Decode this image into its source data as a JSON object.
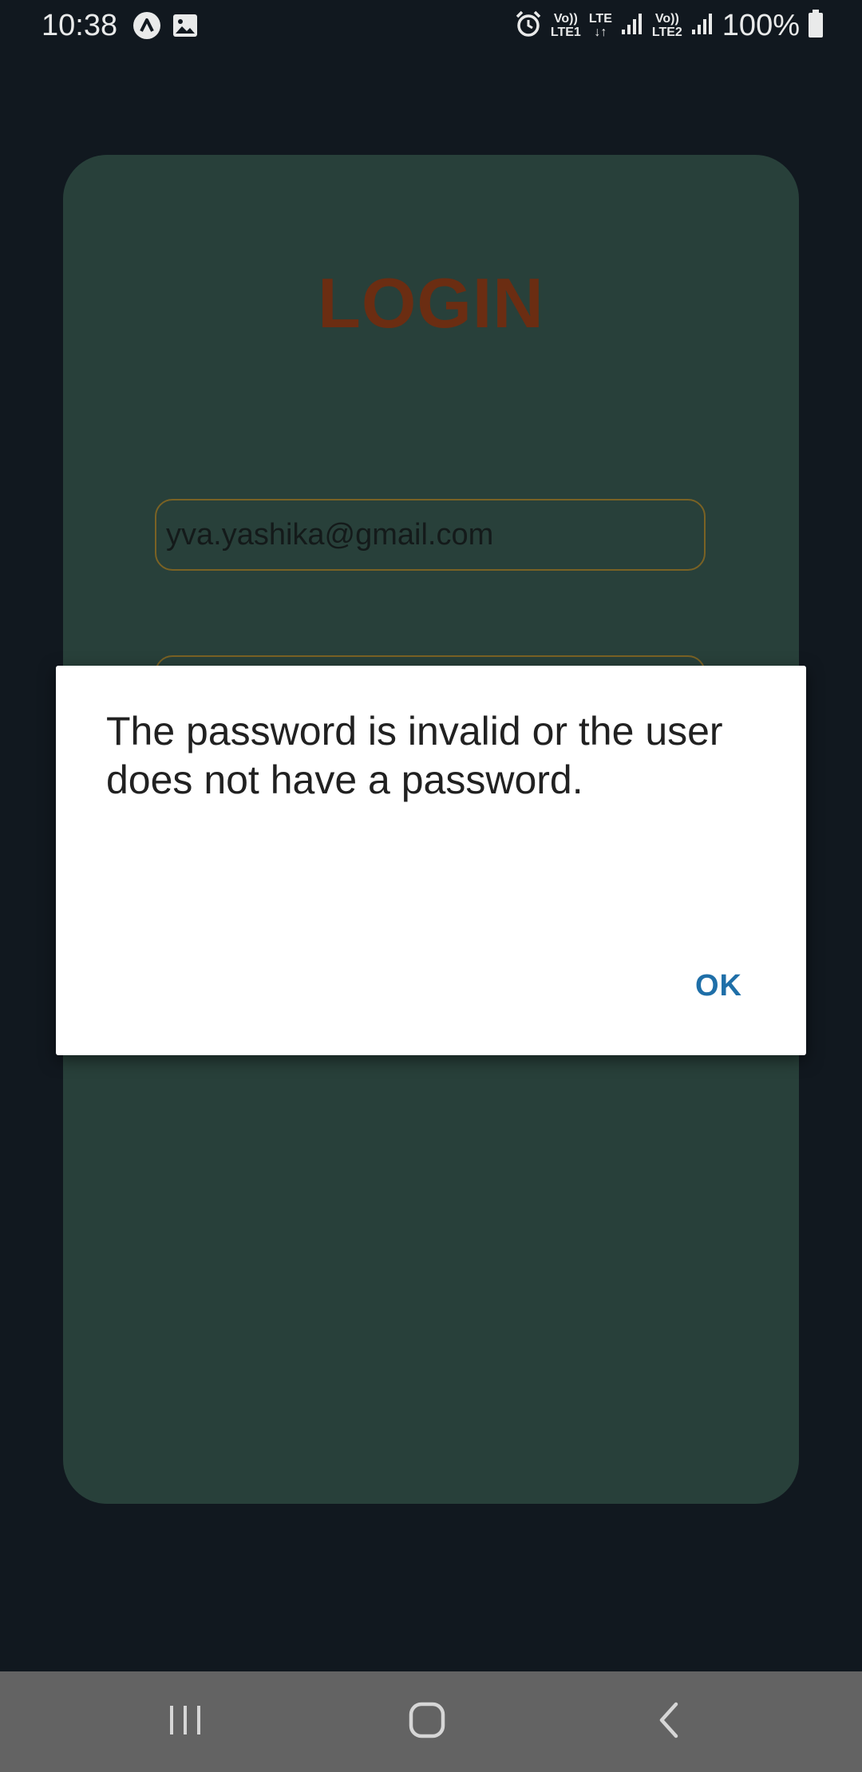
{
  "status_bar": {
    "time": "10:38",
    "sim1_top": "Vo))",
    "sim1_bottom": "LTE1",
    "lte_label": "LTE",
    "sim2_top": "Vo))",
    "sim2_bottom": "LTE2",
    "battery": "100%"
  },
  "login": {
    "title": "LOGIN",
    "email_value": "yva.yashika@gmail.com"
  },
  "dialog": {
    "message": "The password is invalid or the user does not have a password.",
    "ok_label": "OK"
  },
  "colors": {
    "background": "#11181f",
    "card": "#28403a",
    "title": "#6b2d12",
    "field_border": "#7a6224",
    "dialog_button": "#1f6fa8",
    "nav_bar": "#636363"
  },
  "icons": {
    "status_left": [
      "app-notification-icon",
      "image-icon"
    ],
    "status_right": [
      "alarm-icon",
      "signal-icon",
      "signal-icon",
      "battery-icon"
    ],
    "nav": [
      "recent-apps-icon",
      "home-icon",
      "back-icon"
    ]
  }
}
